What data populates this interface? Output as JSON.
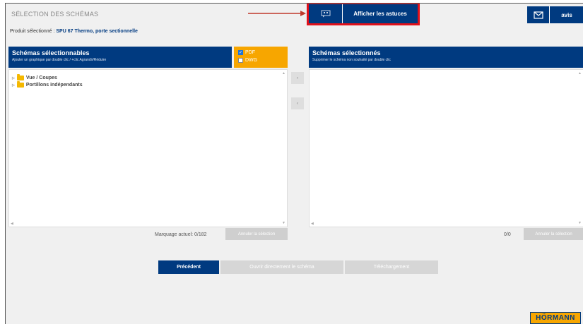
{
  "page": {
    "title": "SÉLECTION DES SCHÉMAS",
    "product_label": "Produit sélectionné :",
    "product_value": "SPU 67 Thermo, porte sectionnelle"
  },
  "toolbar": {
    "tips_label": "Afficher les astuces",
    "avis_label": "avis"
  },
  "left_panel": {
    "title": "Schémas sélectionnables",
    "hint": "Ajouter un graphique par double clic / +clic Agrandir/Réduire",
    "tree": [
      {
        "label": "Vue / Coupes"
      },
      {
        "label": "Portillons indépendants"
      }
    ],
    "counter": "Marquage actuel: 0/182",
    "cancel_label": "Annuler la sélection"
  },
  "formats": [
    {
      "label": "PDF",
      "checked": true
    },
    {
      "label": "DWG",
      "checked": false
    }
  ],
  "move_buttons": {
    "add": "›",
    "remove": "‹"
  },
  "right_panel": {
    "title": "Schémas sélectionnés",
    "hint": "Supprimer le schéma non souhaité par double clic",
    "counter": "0/0",
    "cancel_label": "Annuler la sélection"
  },
  "navigation": {
    "previous": "Précédent",
    "open_direct": "Ouvrir directement le schéma",
    "download": "Téléchargement"
  },
  "brand": {
    "logo_text": "HÖRMANN"
  },
  "colors": {
    "primary": "#003a80",
    "accent": "#f7a600",
    "highlight": "#e0101a"
  }
}
